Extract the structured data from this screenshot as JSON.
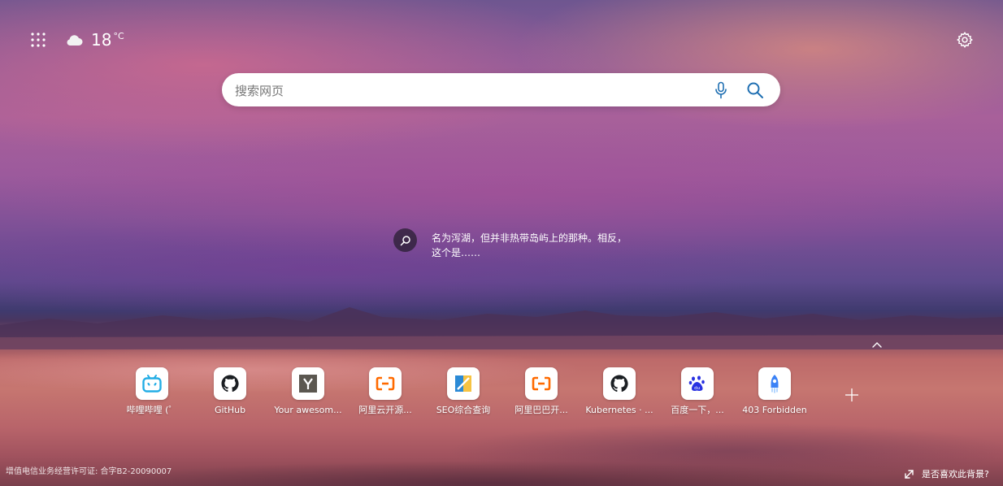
{
  "weather": {
    "temp": "18",
    "unit": "°C",
    "icon": "cloud-icon"
  },
  "search": {
    "placeholder": "搜索网页"
  },
  "image_info": {
    "text": "名为泻湖，但并非热带岛屿上的那种。相反，这个是……"
  },
  "tiles": [
    {
      "label": "哔哩哔哩 (゜",
      "icon": "bilibili-icon",
      "color": "#23ade5"
    },
    {
      "label": "GitHub",
      "icon": "github-icon",
      "color": "#1b1f23"
    },
    {
      "label": "Your awesom...",
      "icon": "y-icon",
      "color": "#5b5750"
    },
    {
      "label": "阿里云开源...",
      "icon": "aliyun-icon",
      "color": "#ff6a00"
    },
    {
      "label": "SEO综合查询",
      "icon": "seo-icon",
      "color": "#2b8ad6"
    },
    {
      "label": "阿里巴巴开...",
      "icon": "alibaba-icon",
      "color": "#ff6a00"
    },
    {
      "label": "Kubernetes · ...",
      "icon": "github-icon",
      "color": "#1b1f23"
    },
    {
      "label": "百度一下，...",
      "icon": "baidu-icon",
      "color": "#2932e1"
    },
    {
      "label": "403 Forbidden",
      "icon": "rocket-icon",
      "color": "#3b82f6"
    }
  ],
  "footer": {
    "license": "增值电信业务经营许可证: 合字B2-20090007",
    "background_prompt": "是否喜欢此背景?"
  }
}
